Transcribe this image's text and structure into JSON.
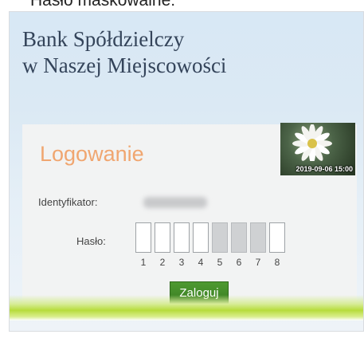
{
  "caption": "Hasło maskowalne:",
  "bank": {
    "name_line1": "Bank Spółdzielczy",
    "name_line2": "w Naszej Miejscowości"
  },
  "login": {
    "title": "Logowanie",
    "photo_timestamp": "2019-09-06 15:00",
    "identifier_label": "Identyfikator:",
    "password_label": "Hasło:",
    "password_positions": [
      {
        "number": "1",
        "masked": false
      },
      {
        "number": "2",
        "masked": false
      },
      {
        "number": "3",
        "masked": false
      },
      {
        "number": "4",
        "masked": false
      },
      {
        "number": "5",
        "masked": true
      },
      {
        "number": "6",
        "masked": true
      },
      {
        "number": "7",
        "masked": true
      },
      {
        "number": "8",
        "masked": false
      }
    ],
    "submit_label": "Zaloguj"
  },
  "colors": {
    "title_orange": "#f0a670",
    "button_green": "#3f8627",
    "bank_name": "#34445a"
  },
  "icons": {
    "photo": "daisy-photo"
  }
}
